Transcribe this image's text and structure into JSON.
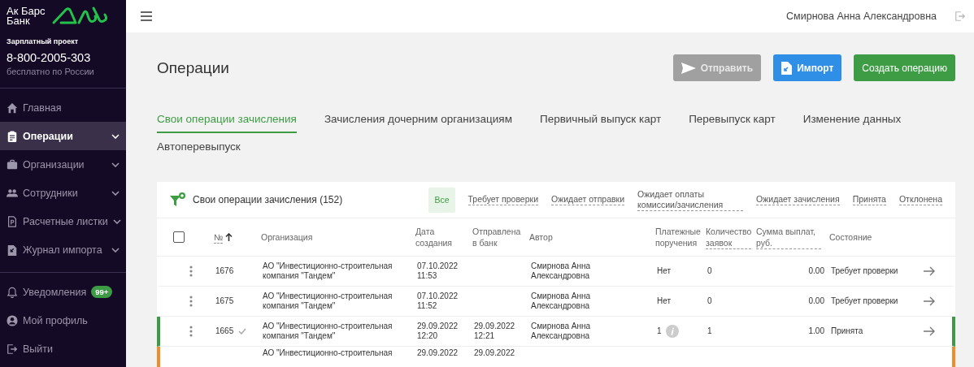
{
  "sidebar": {
    "logo_text": [
      "Ак Барс",
      "Банк"
    ],
    "project_label": "Зарплатный проект",
    "phone": "8-800-2005-303",
    "phone_note": "бесплатно по России",
    "nav": [
      {
        "label": "Главная",
        "expandable": false,
        "selected": false
      },
      {
        "label": "Операции",
        "expandable": true,
        "selected": true
      },
      {
        "label": "Организации",
        "expandable": true,
        "selected": false
      },
      {
        "label": "Сотрудники",
        "expandable": true,
        "selected": false
      },
      {
        "label": "Расчетные листки",
        "expandable": true,
        "selected": false
      },
      {
        "label": "Журнал импорта",
        "expandable": true,
        "selected": false
      }
    ],
    "footer": [
      {
        "label": "Уведомления",
        "badge": "99+"
      },
      {
        "label": "Мой профиль"
      },
      {
        "label": "Выйти"
      }
    ]
  },
  "topbar": {
    "user": "Смирнова Анна Александровна"
  },
  "page": {
    "title": "Операции",
    "actions": [
      {
        "kind": "send",
        "label": "Отправить",
        "disabled": true
      },
      {
        "kind": "import",
        "label": "Импорт",
        "disabled": false
      },
      {
        "kind": "create",
        "label": "Создать операцию",
        "disabled": false
      }
    ]
  },
  "tabs": [
    {
      "label": "Свои операции зачисления",
      "selected": true
    },
    {
      "label": "Зачисления дочерним организациям",
      "selected": false
    },
    {
      "label": "Первичный выпуск карт",
      "selected": false
    },
    {
      "label": "Перевыпуск карт",
      "selected": false
    },
    {
      "label": "Изменение данных",
      "selected": false
    },
    {
      "label": "Автоперевыпуск",
      "selected": false
    }
  ],
  "table": {
    "title": "Свои операции зачисления (152)",
    "select_all_checked": false,
    "filters": [
      {
        "label": "Все",
        "selected": true
      },
      {
        "label": "Требует проверки",
        "selected": false
      },
      {
        "label": "Ожидает отправки",
        "selected": false
      },
      {
        "label": "Ожидает оплаты комиссии/зачисления",
        "selected": false
      },
      {
        "label": "Ожидает зачисления",
        "selected": false
      },
      {
        "label": "Принята",
        "selected": false
      },
      {
        "label": "Отклонена",
        "selected": false
      }
    ],
    "columns": [
      {
        "label": "№",
        "sortable": true,
        "sorted": true
      },
      {
        "label": "Организация",
        "sortable": false,
        "sorted": false
      },
      {
        "label": "Дата создания",
        "sortable": false,
        "sorted": false
      },
      {
        "label": "Отправлена в банк",
        "sortable": false,
        "sorted": false
      },
      {
        "label": "Автор",
        "sortable": false,
        "sorted": false
      },
      {
        "label": "Платежные поручения",
        "sortable": false,
        "sorted": false
      },
      {
        "label": "Количество заявок",
        "sortable": true,
        "sorted": false
      },
      {
        "label": "Сумма выплат, руб.",
        "sortable": true,
        "sorted": false
      },
      {
        "label": "Состояние",
        "sortable": false,
        "sorted": false
      }
    ],
    "rows": [
      {
        "number": "1676",
        "sent": false,
        "organization": "АО \"Инвестиционно-строительная компания \"Тандем\"",
        "created": "07.10.2022 11:53",
        "author": "Смирнова Анна Александровна",
        "payment_orders": "Нет",
        "info": false,
        "count": "0",
        "sum": "0.00",
        "state": "Требует проверки"
      },
      {
        "number": "1675",
        "sent": false,
        "organization": "АО \"Инвестиционно-строительная компания \"Тандем\"",
        "created": "07.10.2022 11:52",
        "author": "Смирнова Анна Александровна",
        "payment_orders": "Нет",
        "info": false,
        "count": "0",
        "sum": "0.00",
        "state": "Требует проверки"
      },
      {
        "number": "1665",
        "sent": true,
        "organization": "АО \"Инвестиционно-строительная компания \"Тандем\"",
        "created": "29.09.2022 12:20",
        "sent_to_bank": "29.09.2022 12:21",
        "author": "Смирнова Анна Александровна",
        "payment_orders": "1",
        "info": true,
        "count": "1",
        "sum": "1.00",
        "state": "Принята",
        "color": "#3d9a45"
      },
      {
        "organization": "АО \"Инвестиционно-строительная",
        "created": "29.09.2022",
        "sent_to_bank": "29.09.2022",
        "color": "#f08c2a"
      }
    ]
  }
}
